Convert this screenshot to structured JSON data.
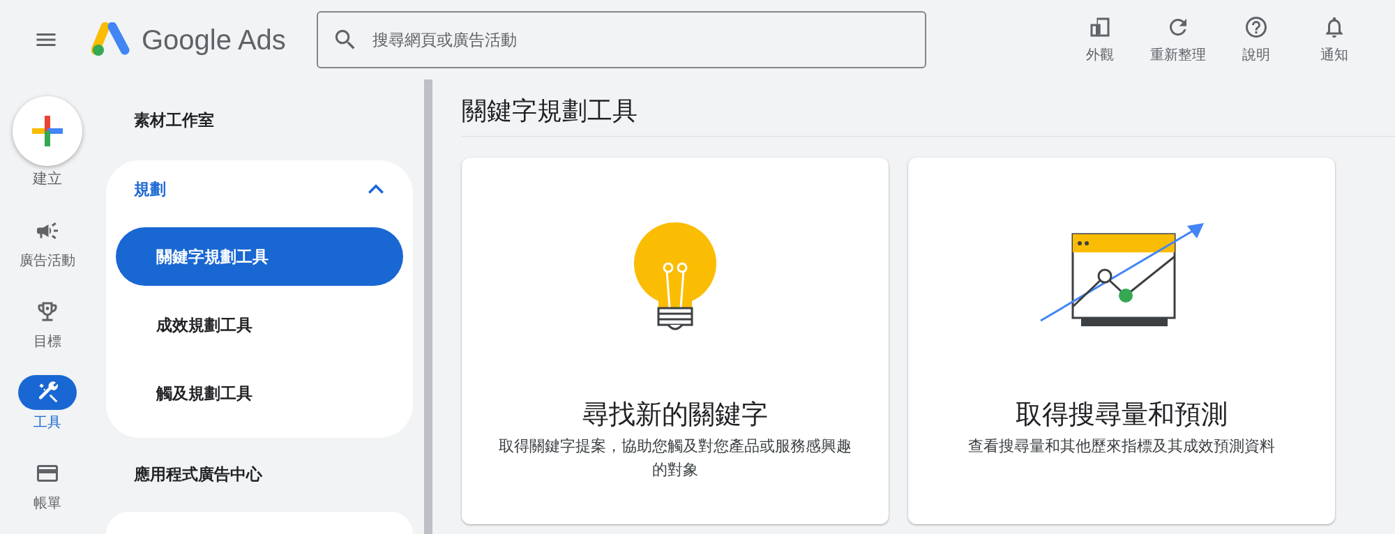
{
  "header": {
    "logo_text": "Google Ads",
    "search": {
      "placeholder": "搜尋網頁或廣告活動"
    },
    "actions": [
      {
        "kind": "appearance",
        "label": "外觀"
      },
      {
        "kind": "refresh",
        "label": "重新整理"
      },
      {
        "kind": "help",
        "label": "說明"
      },
      {
        "kind": "notifications",
        "label": "通知"
      }
    ]
  },
  "rail": {
    "create_label": "建立",
    "items": [
      {
        "kind": "campaigns",
        "label": "廣告活動",
        "selected": false
      },
      {
        "kind": "goals",
        "label": "目標",
        "selected": false
      },
      {
        "kind": "tools",
        "label": "工具",
        "selected": true
      },
      {
        "kind": "billing",
        "label": "帳單",
        "selected": false
      }
    ]
  },
  "nav": {
    "sections": [
      {
        "label": "素材工作室"
      },
      {
        "label": "規劃",
        "expanded": true,
        "children": [
          {
            "label": "關鍵字規劃工具",
            "selected": true
          },
          {
            "label": "成效規劃工具",
            "selected": false
          },
          {
            "label": "觸及規劃工具",
            "selected": false
          }
        ]
      },
      {
        "label": "應用程式廣告中心"
      }
    ]
  },
  "page": {
    "title": "關鍵字規劃工具",
    "cards": [
      {
        "kind": "bulb",
        "title": "尋找新的關鍵字",
        "description": "取得關鍵字提案，協助您觸及對您產品或服務感興趣的對象"
      },
      {
        "kind": "chart",
        "title": "取得搜尋量和預測",
        "description": "查看搜尋量和其他歷來指標及其成效預測資料"
      }
    ]
  }
}
